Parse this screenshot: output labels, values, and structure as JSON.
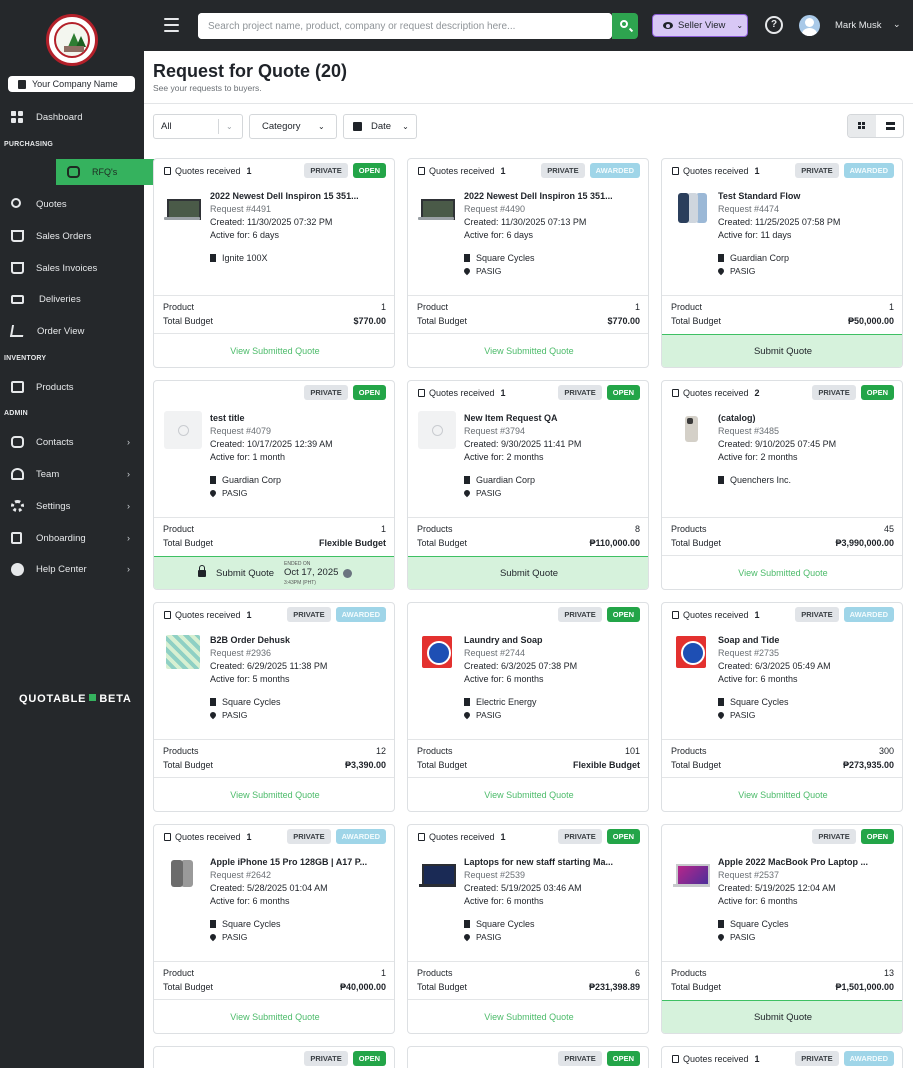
{
  "sidebar": {
    "company_name": "Your Company Name",
    "sections": {
      "purchasing": "PURCHASING",
      "inventory": "INVENTORY",
      "admin": "ADMIN"
    },
    "items": [
      {
        "label": "Dashboard",
        "icon": "dashboard-icon"
      },
      {
        "label": "RFQ's",
        "icon": "rfq-icon",
        "active": true
      },
      {
        "label": "Quotes",
        "icon": "quotes-icon"
      },
      {
        "label": "Sales Orders",
        "icon": "basket-icon"
      },
      {
        "label": "Sales Invoices",
        "icon": "basket-icon"
      },
      {
        "label": "Deliveries",
        "icon": "truck-icon"
      },
      {
        "label": "Order View",
        "icon": "cart-icon"
      },
      {
        "label": "Products",
        "icon": "box-icon"
      },
      {
        "label": "Contacts",
        "icon": "contacts-icon"
      },
      {
        "label": "Team",
        "icon": "team-icon"
      },
      {
        "label": "Settings",
        "icon": "gear-icon"
      },
      {
        "label": "Onboarding",
        "icon": "clipboard-icon"
      },
      {
        "label": "Help Center",
        "icon": "help-icon"
      }
    ],
    "brand": {
      "name": "QUOTABLE",
      "tag": "BETA"
    }
  },
  "topbar": {
    "search_placeholder": "Search project name, product, company or request description here...",
    "seller_view": "Seller View",
    "user_name": "Mark Musk"
  },
  "header": {
    "title": "Request for Quote (20)",
    "subtitle": "See your requests to buyers."
  },
  "filters": {
    "all": "All",
    "category": "Category",
    "date": "Date"
  },
  "colors": {
    "accent": "#35b25e",
    "open_badge": "#23a548",
    "awarded_badge": "#9fd5e8",
    "sidebar_bg": "#25282b",
    "seller_view_bg": "#d8c8f5"
  },
  "cards": [
    {
      "quotes_label": "Quotes received",
      "quotes_count": "1",
      "privacy": "PRIVATE",
      "status": "OPEN",
      "thumb": "laptop",
      "title": "2022 Newest Dell Inspiron 15 351...",
      "request": "Request #4491",
      "created": "Created: 11/30/2025 07:32 PM",
      "active": "Active for: 6 days",
      "company": "Ignite 100X",
      "location": "",
      "product_label": "Product",
      "product_count": "1",
      "budget_label": "Total Budget",
      "budget": "$770.00",
      "action": "View Submitted Quote",
      "action_type": "link"
    },
    {
      "quotes_label": "Quotes received",
      "quotes_count": "1",
      "privacy": "PRIVATE",
      "status": "AWARDED",
      "thumb": "laptop",
      "title": "2022 Newest Dell Inspiron 15 351...",
      "request": "Request #4490",
      "created": "Created: 11/30/2025 07:13 PM",
      "active": "Active for: 6 days",
      "company": "Square Cycles",
      "location": "PASIG",
      "product_label": "Product",
      "product_count": "1",
      "budget_label": "Total Budget",
      "budget": "$770.00",
      "action": "View Submitted Quote",
      "action_type": "link"
    },
    {
      "quotes_label": "Quotes received",
      "quotes_count": "1",
      "privacy": "PRIVATE",
      "status": "AWARDED",
      "thumb": "phone",
      "title": "Test Standard Flow",
      "request": "Request #4474",
      "created": "Created: 11/25/2025 07:58 PM",
      "active": "Active for: 11 days",
      "company": "Guardian Corp",
      "location": "PASIG",
      "product_label": "Product",
      "product_count": "1",
      "budget_label": "Total Budget",
      "budget": "₱50,000.00",
      "action": "Submit Quote",
      "action_type": "button"
    },
    {
      "quotes_label": "",
      "quotes_count": "",
      "privacy": "PRIVATE",
      "status": "OPEN",
      "thumb": "placeholder",
      "title": "test title",
      "request": "Request #4079",
      "created": "Created: 10/17/2025 12:39 AM",
      "active": "Active for: 1 month",
      "company": "Guardian Corp",
      "location": "PASIG",
      "product_label": "Product",
      "product_count": "1",
      "budget_label": "Total Budget",
      "budget": "Flexible Budget",
      "action": "Submit Quote",
      "action_type": "locked",
      "ended_label": "ENDED ON",
      "ended_date": "Oct 17, 2025",
      "ended_time": "3:43PM (PHT)"
    },
    {
      "quotes_label": "Quotes received",
      "quotes_count": "1",
      "privacy": "PRIVATE",
      "status": "OPEN",
      "thumb": "placeholder",
      "title": "New Item Request QA",
      "request": "Request #3794",
      "created": "Created: 9/30/2025 11:41 PM",
      "active": "Active for: 2 months",
      "company": "Guardian Corp",
      "location": "PASIG",
      "product_label": "Products",
      "product_count": "8",
      "budget_label": "Total Budget",
      "budget": "₱110,000.00",
      "action": "Submit Quote",
      "action_type": "button"
    },
    {
      "quotes_label": "Quotes received",
      "quotes_count": "2",
      "privacy": "PRIVATE",
      "status": "OPEN",
      "thumb": "iphone",
      "title": "(catalog)",
      "request": "Request #3485",
      "created": "Created: 9/10/2025 07:45 PM",
      "active": "Active for: 2 months",
      "company": "Quenchers Inc.",
      "location": "",
      "product_label": "Products",
      "product_count": "45",
      "budget_label": "Total Budget",
      "budget": "₱3,990,000.00",
      "action": "View Submitted Quote",
      "action_type": "link"
    },
    {
      "quotes_label": "Quotes received",
      "quotes_count": "1",
      "privacy": "PRIVATE",
      "status": "AWARDED",
      "thumb": "b2b",
      "title": "B2B Order Dehusk",
      "request": "Request #2936",
      "created": "Created: 6/29/2025 11:38 PM",
      "active": "Active for: 5 months",
      "company": "Square Cycles",
      "location": "PASIG",
      "product_label": "Products",
      "product_count": "12",
      "budget_label": "Total Budget",
      "budget": "₱3,390.00",
      "action": "View Submitted Quote",
      "action_type": "link"
    },
    {
      "quotes_label": "",
      "quotes_count": "",
      "privacy": "PRIVATE",
      "status": "OPEN",
      "thumb": "soap",
      "title": "Laundry and Soap",
      "request": "Request #2744",
      "created": "Created: 6/3/2025 07:38 PM",
      "active": "Active for: 6 months",
      "company": "Electric Energy",
      "location": "PASIG",
      "product_label": "Products",
      "product_count": "101",
      "budget_label": "Total Budget",
      "budget": "Flexible Budget",
      "action": "View Submitted Quote",
      "action_type": "link"
    },
    {
      "quotes_label": "Quotes received",
      "quotes_count": "1",
      "privacy": "PRIVATE",
      "status": "AWARDED",
      "thumb": "soap",
      "title": "Soap and Tide",
      "request": "Request #2735",
      "created": "Created: 6/3/2025 05:49 AM",
      "active": "Active for: 6 months",
      "company": "Square Cycles",
      "location": "PASIG",
      "product_label": "Products",
      "product_count": "300",
      "budget_label": "Total Budget",
      "budget": "₱273,935.00",
      "action": "View Submitted Quote",
      "action_type": "link"
    },
    {
      "quotes_label": "Quotes received",
      "quotes_count": "1",
      "privacy": "PRIVATE",
      "status": "AWARDED",
      "thumb": "iphone15",
      "title": "Apple iPhone 15 Pro 128GB | A17 P...",
      "request": "Request #2642",
      "created": "Created: 5/28/2025 01:04 AM",
      "active": "Active for: 6 months",
      "company": "Square Cycles",
      "location": "PASIG",
      "product_label": "Product",
      "product_count": "1",
      "budget_label": "Total Budget",
      "budget": "₱40,000.00",
      "action": "View Submitted Quote",
      "action_type": "link"
    },
    {
      "quotes_label": "Quotes received",
      "quotes_count": "1",
      "privacy": "PRIVATE",
      "status": "OPEN",
      "thumb": "dark",
      "title": "Laptops for new staff starting Ma...",
      "request": "Request #2539",
      "created": "Created: 5/19/2025 03:46 AM",
      "active": "Active for: 6 months",
      "company": "Square Cycles",
      "location": "PASIG",
      "product_label": "Products",
      "product_count": "6",
      "budget_label": "Total Budget",
      "budget": "₱231,398.89",
      "action": "View Submitted Quote",
      "action_type": "link"
    },
    {
      "quotes_label": "",
      "quotes_count": "",
      "privacy": "PRIVATE",
      "status": "OPEN",
      "thumb": "mac",
      "title": "Apple 2022 MacBook Pro Laptop ...",
      "request": "Request #2537",
      "created": "Created: 5/19/2025 12:04 AM",
      "active": "Active for: 6 months",
      "company": "Square Cycles",
      "location": "PASIG",
      "product_label": "Products",
      "product_count": "13",
      "budget_label": "Total Budget",
      "budget": "₱1,501,000.00",
      "action": "Submit Quote",
      "action_type": "button"
    },
    {
      "quotes_label": "",
      "quotes_count": "",
      "privacy": "PRIVATE",
      "status": "OPEN",
      "partial": true
    },
    {
      "quotes_label": "",
      "quotes_count": "",
      "privacy": "PRIVATE",
      "status": "OPEN",
      "partial": true
    },
    {
      "quotes_label": "Quotes received",
      "quotes_count": "1",
      "privacy": "PRIVATE",
      "status": "AWARDED",
      "partial": true
    }
  ]
}
